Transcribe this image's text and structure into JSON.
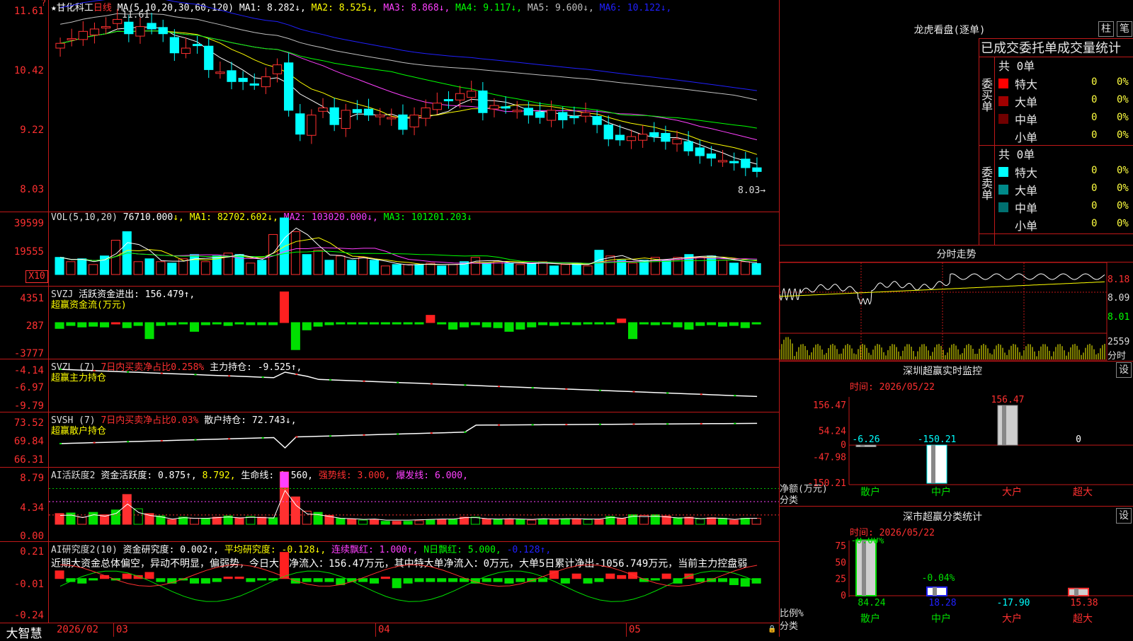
{
  "stock": {
    "name": "甘化科工",
    "period": "日线",
    "star": "★"
  },
  "price_panel": {
    "ma_prefix": "MA(5,10,20,30,60,120)",
    "ma": [
      {
        "label": "MA1: 8.282",
        "arrow": "↓",
        "color": "#ffffff"
      },
      {
        "label": "MA2: 8.525",
        "arrow": "↓",
        "color": "#ffff00"
      },
      {
        "label": "MA3: 8.868",
        "arrow": "↓",
        "color": "#ff40ff"
      },
      {
        "label": "MA4: 9.117",
        "arrow": "↓",
        "color": "#00ff00"
      },
      {
        "label": "MA5: 9.600",
        "arrow": "↓",
        "color": "#c0c0c0"
      },
      {
        "label": "MA6: 10.122",
        "arrow": "↓",
        "color": "#2020ff"
      }
    ],
    "y_ticks": [
      "11.61",
      "10.42",
      "9.22",
      "8.03"
    ],
    "high_label": "11.61",
    "low_label": "8.03→"
  },
  "vol_panel": {
    "title": "VOL(5,10,20)",
    "value": "76710.000",
    "ma1": "MA1: 82702.602",
    "ma2": "MA2: 103020.000",
    "ma3": "MA3: 101201.203",
    "y_ticks": [
      "39599",
      "19555"
    ],
    "unit": "X10"
  },
  "svzj_panel": {
    "title": "SVZJ",
    "line": "活跃资金进出: 156.479↑,",
    "sub": "超赢资金流(万元)",
    "y_ticks": [
      "4351",
      "287",
      "-3777"
    ]
  },
  "svzl_panel": {
    "title": "SVZL (7)",
    "a": "7日内买卖净占比0.258%",
    "b": "主力持仓: -9.525↑,",
    "sub": "超赢主力持仓",
    "y_ticks": [
      "-4.14",
      "-6.97",
      "-9.79"
    ]
  },
  "svsh_panel": {
    "title": "SVSH (7)",
    "a": "7日内买卖净占比0.03%",
    "b": "散户持仓: 72.743↓,",
    "sub": "超赢散户持仓",
    "y_ticks": [
      "73.52",
      "69.84",
      "66.31"
    ]
  },
  "ai1_panel": {
    "title": "AI活跃度2",
    "a": "资金活跃度: 0.875↑,",
    "b": "8.792,",
    "c": "生命线: 1.560,",
    "d": "强势线: 3.000,",
    "e": "爆发线: 6.000,",
    "y_ticks": [
      "8.79",
      "4.34",
      "0.00"
    ]
  },
  "ai2_panel": {
    "title": "AI研究度2(10)",
    "a": "资金研究度: 0.002↑,",
    "b": "平均研究度: -0.128↓,",
    "c": "连续飘红: 1.000↑,",
    "d": "N日飘红: 5.000,",
    "e": "-0.128↑,",
    "comment": "近期大资金总体偏空，异动不明显，偏弱势，今日大单净流入：156.47万元，其中特大单净流入：0万元，大单5日累计净出-1056.749万元，当前主力控盘弱",
    "y_ticks": [
      "0.21",
      "-0.01",
      "-0.24"
    ]
  },
  "time_axis": {
    "brand": "大智慧",
    "labels": [
      "2026/02",
      "03",
      "04",
      "05"
    ]
  },
  "dragon": {
    "title": "龙虎看盘(逐单)",
    "btn1": "柱",
    "btn2": "笔",
    "subtitle": "已成交委托单成交量统计",
    "buy": {
      "side": "委买单",
      "total": "共 0单",
      "rows": [
        {
          "name": "特大",
          "count": "0",
          "pct": "0%",
          "color": "#ff0000"
        },
        {
          "name": "大单",
          "count": "0",
          "pct": "0%",
          "color": "#a00000"
        },
        {
          "name": "中单",
          "count": "0",
          "pct": "0%",
          "color": "#700000"
        },
        {
          "name": "小单",
          "count": "0",
          "pct": "0%",
          "color": "#000000"
        }
      ]
    },
    "sell": {
      "side": "委卖单",
      "total": "共 0单",
      "rows": [
        {
          "name": "特大",
          "count": "0",
          "pct": "0%",
          "color": "#00ffff"
        },
        {
          "name": "大单",
          "count": "0",
          "pct": "0%",
          "color": "#008a8a"
        },
        {
          "name": "中单",
          "count": "0",
          "pct": "0%",
          "color": "#007070"
        },
        {
          "name": "小单",
          "count": "0",
          "pct": "0%",
          "color": "#000000"
        }
      ]
    }
  },
  "intraday": {
    "title": "分时走势",
    "price_ticks": [
      "8.18",
      "8.09",
      "8.01"
    ],
    "vol_tick": "2559",
    "vol_label": "分时"
  },
  "monitor": {
    "title": "深圳超赢实时监控",
    "btn": "设",
    "time": "时间: 2026/05/22",
    "y_ticks": [
      "156.47",
      "54.24",
      "0",
      "-47.98",
      "-150.21"
    ],
    "ylabel": "净额(万元)",
    "xlabel": "分类",
    "cats": [
      "散户",
      "中户",
      "大户",
      "超大"
    ],
    "values": [
      -6.26,
      -150.21,
      156.47,
      0
    ],
    "value_labels": [
      "-6.26",
      "-150.21",
      "156.47",
      "0"
    ]
  },
  "classify": {
    "title": "深市超赢分类统计",
    "btn": "设",
    "time": "时间: 2026/05/22",
    "y_ticks": [
      "75",
      "50",
      "25",
      "0"
    ],
    "ylabel": "比例%",
    "xlabel": "分类",
    "cats": [
      "散户",
      "中户",
      "大户",
      "超大"
    ],
    "values": [
      84.24,
      18.28,
      -17.9,
      15.38
    ],
    "value_labels": [
      "84.24",
      "18.28",
      "-17.90",
      "15.38"
    ],
    "top_labels": [
      "-0.00%",
      "-0.04%"
    ]
  },
  "chart_data": [
    {
      "type": "candlestick",
      "title": "甘化科工 日线",
      "ylim": [
        8.03,
        11.61
      ],
      "close": [
        11.0,
        11.1,
        11.25,
        11.3,
        11.35,
        11.5,
        11.2,
        11.35,
        11.3,
        11.2,
        10.8,
        10.9,
        10.95,
        10.45,
        10.4,
        10.2,
        10.2,
        10.15,
        10.3,
        10.55,
        9.6,
        9.1,
        9.5,
        9.65,
        9.3,
        9.6,
        9.55,
        9.5,
        9.5,
        9.45,
        9.2,
        9.5,
        9.65,
        9.75,
        9.8,
        9.95,
        10.0,
        9.55,
        9.7,
        9.65,
        9.6,
        9.5,
        9.45,
        9.6,
        9.4,
        9.45,
        9.55,
        9.3,
        9.0,
        8.98,
        9.05,
        9.1,
        9.05,
        8.95,
        9.0,
        8.75,
        8.65,
        8.6,
        8.55,
        8.5,
        8.4,
        8.32
      ],
      "ma_series": [
        "MA1",
        "MA2",
        "MA3",
        "MA4",
        "MA5",
        "MA6"
      ]
    },
    {
      "type": "bar",
      "title": "VOL(5,10,20)",
      "ylim": [
        0,
        39599
      ],
      "values": [
        12000,
        9000,
        11000,
        7000,
        13000,
        24000,
        30000,
        9000,
        11000,
        9000,
        8000,
        11000,
        14000,
        9000,
        13000,
        15000,
        14000,
        8000,
        10000,
        28000,
        39599,
        30000,
        14000,
        17000,
        10000,
        13000,
        10000,
        12000,
        10000,
        6000,
        7000,
        7000,
        7000,
        8000,
        6000,
        7000,
        9000,
        12000,
        8000,
        9000,
        8000,
        7000,
        8000,
        9000,
        6000,
        7000,
        8000,
        6000,
        17000,
        13000,
        10000,
        8000,
        10000,
        12000,
        10000,
        12000,
        14000,
        12000,
        13000,
        10000,
        8000,
        9000,
        7671
      ]
    },
    {
      "type": "bar",
      "title": "SVZJ 活跃资金进出",
      "ylim": [
        -3777,
        4351
      ],
      "values": [
        -800,
        -400,
        -600,
        -500,
        -600,
        0,
        -700,
        -400,
        -2200,
        -400,
        -300,
        -200,
        -1200,
        -300,
        -200,
        -400,
        -200,
        -300,
        -300,
        -300,
        4200,
        -3700,
        -1000,
        -500,
        -300,
        -200,
        -200,
        -200,
        -200,
        -200,
        -200,
        -200,
        -200,
        1000,
        -200,
        -900,
        -600,
        -300,
        -600,
        -700,
        -1200,
        -900,
        -600,
        -300,
        -400,
        -200,
        -300,
        -200,
        -200,
        -200,
        500,
        -2200,
        -200,
        -300,
        -200,
        -600,
        -900,
        -400,
        -300,
        -500,
        -400,
        -700,
        -200
      ]
    },
    {
      "type": "line",
      "title": "SVZL 主力持仓",
      "ylim": [
        -9.79,
        -4.14
      ]
    },
    {
      "type": "line",
      "title": "SVSH 散户持仓",
      "ylim": [
        66.31,
        73.52
      ]
    },
    {
      "type": "bar",
      "title": "AI活跃度2",
      "ylim": [
        0,
        8.79
      ],
      "values": [
        1.8,
        1.9,
        1.2,
        2.0,
        1.6,
        2.4,
        5.0,
        2.6,
        1.8,
        1.4,
        0.8,
        1.2,
        1.0,
        1.0,
        1.2,
        1.4,
        1.1,
        1.3,
        1.2,
        1.1,
        8.79,
        4.6,
        2.2,
        2.0,
        1.5,
        1.0,
        0.9,
        0.7,
        0.8,
        0.5,
        0.5,
        0.5,
        0.6,
        0.7,
        0.8,
        0.8,
        1.2,
        1.2,
        0.9,
        0.8,
        0.9,
        0.8,
        0.7,
        0.9,
        0.8,
        0.9,
        0.9,
        0.8,
        0.8,
        1.3,
        1.0,
        1.6,
        1.5,
        1.6,
        1.4,
        1.1,
        1.2,
        0.9,
        1.1,
        1.0,
        0.7,
        1.0,
        1.0
      ]
    },
    {
      "type": "bar",
      "title": "AI研究度2(10)",
      "ylim": [
        -0.24,
        0.21
      ],
      "values": [
        0.05,
        -0.02,
        -0.03,
        -0.01,
        0.02,
        -0.01,
        0.03,
        0.02,
        0.04,
        -0.02,
        -0.03,
        -0.01,
        -0.03,
        -0.03,
        -0.02,
        0.01,
        0.01,
        -0.02,
        -0.01,
        -0.01,
        0.17,
        -0.03,
        -0.02,
        -0.02,
        -0.02,
        -0.04,
        -0.02,
        -0.02,
        -0.03,
        0.01,
        -0.06,
        -0.03,
        -0.02,
        -0.02,
        -0.02,
        -0.02,
        -0.02,
        -0.03,
        -0.02,
        -0.02,
        -0.03,
        -0.02,
        -0.02,
        -0.02,
        0.05,
        -0.03,
        0.03,
        -0.03,
        -0.02,
        0.03,
        0.02,
        0.04,
        -0.02,
        -0.01,
        0.03,
        -0.03,
        0.03,
        -0.02,
        -0.02,
        -0.02,
        -0.04,
        -0.05,
        -0.03
      ]
    },
    {
      "type": "bar",
      "title": "深圳超赢实时监控",
      "categories": [
        "散户",
        "中户",
        "大户",
        "超大"
      ],
      "values": [
        -6.26,
        -150.21,
        156.47,
        0
      ],
      "ylim": [
        -150.21,
        156.47
      ]
    },
    {
      "type": "bar",
      "title": "深市超赢分类统计",
      "categories": [
        "散户",
        "中户",
        "大户",
        "超大"
      ],
      "values": [
        84.24,
        18.28,
        -17.9,
        15.38
      ],
      "ylim": [
        0,
        75
      ]
    }
  ]
}
